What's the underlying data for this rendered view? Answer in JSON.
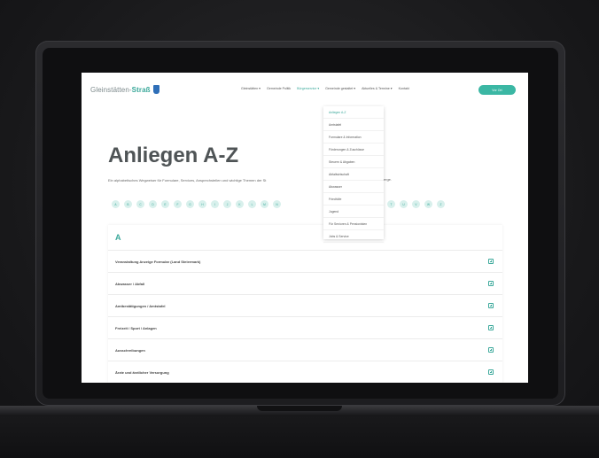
{
  "header": {
    "logo_text_part1": "Gleinstätten",
    "logo_text_part2": "Straß",
    "nav": [
      {
        "label": "Gleinstätten ▾",
        "active": false
      },
      {
        "label": "Gemeinde Politik",
        "active": false
      },
      {
        "label": "Bürgerservice ▾",
        "active": true
      },
      {
        "label": "Gemeinde gestaltet ▾",
        "active": false
      },
      {
        "label": "Aktuelles & Termine ▾",
        "active": false
      },
      {
        "label": "Kontakt",
        "active": false
      }
    ],
    "cta_label": "Vor Ort"
  },
  "dropdown": {
    "items": [
      {
        "label": "Anliegen A-Z",
        "active": true
      },
      {
        "label": "Amtstafel",
        "active": false
      },
      {
        "label": "Formulare & Information",
        "active": false
      },
      {
        "label": "Förderungen & Zuschüsse",
        "active": false
      },
      {
        "label": "Steuern & Abgaben",
        "active": false
      },
      {
        "label": "Abfallwirtschaft",
        "active": false
      },
      {
        "label": "Abwasser",
        "active": false
      },
      {
        "label": "Friedhöfe",
        "active": false
      },
      {
        "label": "Jugend",
        "active": false
      },
      {
        "label": "Für Senioren & Pensionisten",
        "active": false
      },
      {
        "label": "Jobs & Service",
        "active": false
      }
    ]
  },
  "page": {
    "title": "Anliegen A-Z",
    "intro": "Ein alphabetisches Wegweiser für Formulare, Services, Ansprechstellen und wichtige Themen der St",
    "intro_end": "ierge.",
    "letters_left": [
      "A",
      "B",
      "C",
      "D",
      "E",
      "F",
      "G",
      "H",
      "I",
      "J",
      "K",
      "L",
      "M",
      "N"
    ],
    "letters_right": [
      "T",
      "U",
      "V",
      "W",
      "Z"
    ]
  },
  "list": {
    "heading": "A",
    "rows": [
      "Veranstaltung Anzeige Formular (Land Steiermark)",
      "Abwasser / Abfall",
      "Amtbestätigungen / Amtstafel",
      "Freizeit / Sport / Anlagen",
      "Ausschreibungen",
      "Ärzte und ärztlicher Versorgung"
    ]
  }
}
